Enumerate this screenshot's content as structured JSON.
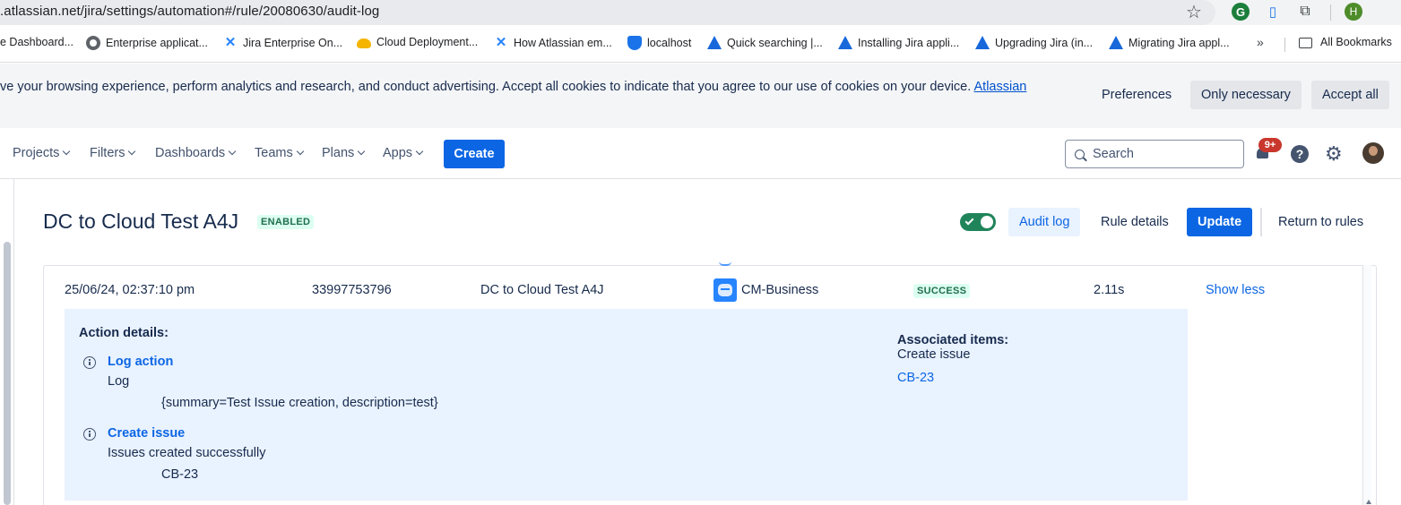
{
  "browser": {
    "url": ".atlassian.net/jira/settings/automation#/rule/20080630/audit-log",
    "profile_initial": "H",
    "bookmarks": [
      {
        "label": "e Dashboard...",
        "icon": "none"
      },
      {
        "label": "Enterprise applicat...",
        "icon": "globe-icon"
      },
      {
        "label": "Jira Enterprise On...",
        "icon": "jira-icon"
      },
      {
        "label": "Cloud Deployment...",
        "icon": "cloud-icon"
      },
      {
        "label": "How Atlassian em...",
        "icon": "jira-icon"
      },
      {
        "label": "localhost",
        "icon": "shield-icon"
      },
      {
        "label": "Quick searching |...",
        "icon": "atlassian-icon"
      },
      {
        "label": "Installing Jira appli...",
        "icon": "atlassian-icon"
      },
      {
        "label": "Upgrading Jira (in...",
        "icon": "atlassian-icon"
      },
      {
        "label": "Migrating Jira appl...",
        "icon": "atlassian-icon"
      }
    ],
    "more_label": "»",
    "all_bookmarks_label": "All Bookmarks"
  },
  "cookie_banner": {
    "text": "ve your browsing experience, perform analytics and research, and conduct advertising. Accept all cookies to indicate that you agree to our use of cookies on your device. ",
    "link": "Atlassian",
    "preferences_label": "Preferences",
    "only_necessary_label": "Only necessary",
    "accept_all_label": "Accept all"
  },
  "topnav": {
    "items": [
      "Projects",
      "Filters",
      "Dashboards",
      "Teams",
      "Plans",
      "Apps"
    ],
    "create_label": "Create",
    "search_placeholder": "Search",
    "notifications_badge": "9+",
    "help_glyph": "?"
  },
  "rule": {
    "title": "DC to Cloud Test A4J",
    "status": "ENABLED",
    "enabled": true,
    "audit_log_label": "Audit log",
    "rule_details_label": "Rule details",
    "update_label": "Update",
    "return_label": "Return to rules"
  },
  "audit_entry": {
    "date": "25/06/24, 02:37:10 pm",
    "id": "33997753796",
    "rule_name": "DC to Cloud Test A4J",
    "project": "CM-Business",
    "status": "SUCCESS",
    "duration": "2.11s",
    "toggle_label": "Show less",
    "details": {
      "heading": "Action details:",
      "actions": [
        {
          "title": "Log action",
          "line1": "Log",
          "line2": "{summary=Test Issue creation, description=test}"
        },
        {
          "title": "Create issue",
          "line1": "Issues created successfully",
          "line2": "CB-23"
        }
      ],
      "associated_title": "Associated items:",
      "associated_type": "Create issue",
      "associated_link": "CB-23"
    }
  },
  "colors": {
    "primary": "#0c66e4",
    "success_bg": "#dcfff1",
    "success_text": "#216e4e",
    "details_bg": "#e9f2ff",
    "badge_red": "#c9372c"
  }
}
